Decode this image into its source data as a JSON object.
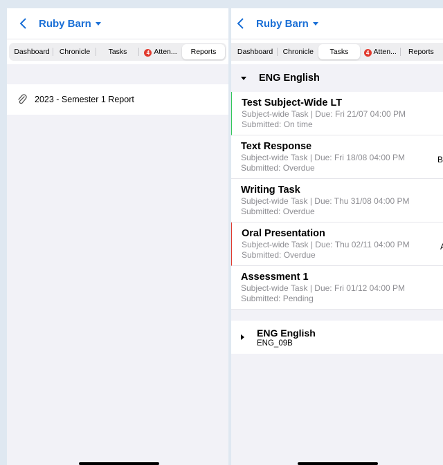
{
  "left": {
    "header": {
      "title": "Ruby Barn"
    },
    "tabs": [
      {
        "label": "Dashboard"
      },
      {
        "label": "Chronicle"
      },
      {
        "label": "Tasks"
      },
      {
        "label": "Atten...",
        "badge": "4"
      },
      {
        "label": "Reports",
        "active": true
      }
    ],
    "reports": [
      {
        "label": "2023 - Semester 1 Report",
        "icon": "paperclip-icon"
      }
    ]
  },
  "right": {
    "header": {
      "title": "Ruby Barn"
    },
    "tabs": [
      {
        "label": "Dashboard"
      },
      {
        "label": "Chronicle"
      },
      {
        "label": "Tasks",
        "active": true
      },
      {
        "label": "Atten...",
        "badge": "4"
      },
      {
        "label": "Reports"
      }
    ],
    "group1": {
      "title": "ENG English",
      "tasks": [
        {
          "name": "Test Subject-Wide LT",
          "line1": "Subject-wide Task | Due: Fri 21/07 04:00 PM",
          "line2": "Submitted: On time",
          "grade": ""
        },
        {
          "name": "Text Response",
          "line1": "Subject-wide Task | Due: Fri 18/08 04:00 PM",
          "line2": "Submitted: Overdue",
          "grade": "B-"
        },
        {
          "name": "Writing Task",
          "line1": "Subject-wide Task | Due: Thu 31/08 04:00 PM",
          "line2": "Submitted: Overdue",
          "grade": ""
        },
        {
          "name": "Oral Presentation",
          "line1": "Subject-wide Task | Due: Thu 02/11 04:00 PM",
          "line2": "Submitted: Overdue",
          "grade": "A"
        },
        {
          "name": "Assessment 1",
          "line1": "Subject-wide Task | Due: Fri 01/12 04:00 PM",
          "line2": "Submitted: Pending",
          "grade": ""
        }
      ]
    },
    "group2": {
      "title": "ENG English",
      "subtitle": "ENG_09B"
    }
  },
  "colors": {
    "accent": "#1a6fd6",
    "badge": "#e13a2e",
    "ontime": "#34c759",
    "overdue": "#e13a2e"
  }
}
